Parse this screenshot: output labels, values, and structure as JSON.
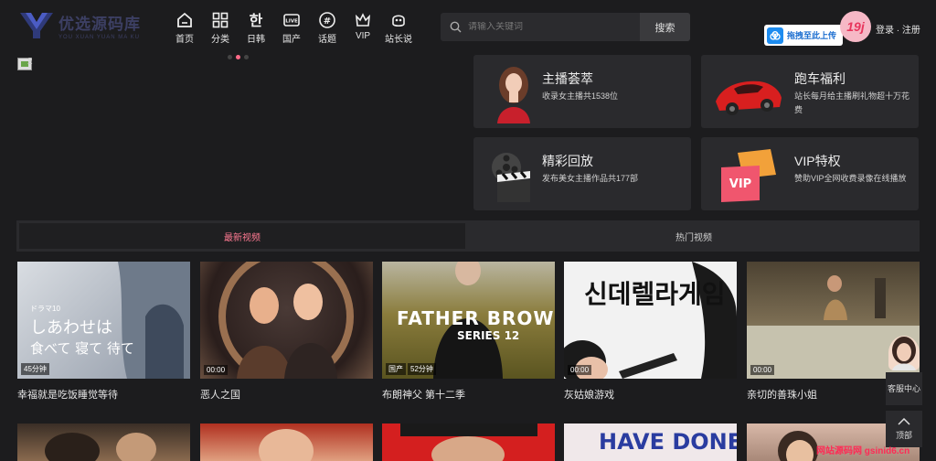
{
  "brand": {
    "name": "优选源码库",
    "tagline": "YOU XUAN YUAN MA KU"
  },
  "nav": [
    {
      "label": "首页",
      "icon": "home-icon"
    },
    {
      "label": "分类",
      "icon": "category-grid-icon"
    },
    {
      "label": "日韩",
      "icon": "korean-char-icon"
    },
    {
      "label": "国产",
      "icon": "live-tv-icon"
    },
    {
      "label": "话题",
      "icon": "hashtag-icon"
    },
    {
      "label": "VIP",
      "icon": "crown-icon"
    },
    {
      "label": "站长说",
      "icon": "smile-face-icon"
    }
  ],
  "search": {
    "placeholder": "请输入关键词",
    "button": "搜索"
  },
  "upload": {
    "label": "拖拽至此上传"
  },
  "user": {
    "avatar_text": "19j",
    "login": "登录 · 注册"
  },
  "banner": {
    "alt": "2"
  },
  "features": [
    {
      "title": "主播荟萃",
      "desc": "收录女主播共1538位"
    },
    {
      "title": "跑车福利",
      "desc": "站长每月给主播刷礼物超十万花费"
    },
    {
      "title": "精彩回放",
      "desc": "发布美女主播作品共177部"
    },
    {
      "title": "VIP特权",
      "desc": "赞助VIP全网收费录像在线播放"
    }
  ],
  "tabs": [
    {
      "label": "最新视频"
    },
    {
      "label": "热门视频"
    }
  ],
  "videos": [
    {
      "title": "幸福就是吃饭睡觉等待",
      "tags": [
        "45分钟"
      ],
      "colors": [
        "#c9cdd3",
        "#8f98a6"
      ]
    },
    {
      "title": "恶人之国",
      "tags": [
        "00:00"
      ],
      "colors": [
        "#3a2a2a",
        "#b08a70"
      ]
    },
    {
      "title": "布朗神父 第十二季",
      "tags": [
        "国产",
        "52分钟"
      ],
      "colors": [
        "#9a8a3e",
        "#2b2a22"
      ]
    },
    {
      "title": "灰姑娘游戏",
      "tags": [
        "00:00"
      ],
      "colors": [
        "#f2f2f2",
        "#d8d8d8"
      ]
    },
    {
      "title": "亲切的善珠小姐",
      "tags": [
        "00:00"
      ],
      "colors": [
        "#6a5d48",
        "#a9a48f"
      ]
    }
  ],
  "thumb_texts": {
    "v1": [
      "ドラマ10",
      "しあわせは",
      "食べて 寝て 待て"
    ],
    "v3": [
      "FATHER BROWN",
      "SERIES 12"
    ],
    "v4": [
      "신데렐라게임"
    ],
    "row2_v4": "HAVE DONE"
  },
  "side": {
    "service": "客服中心",
    "top": "顶部"
  },
  "watermark": "网站源码网 gsinid6.cn"
}
